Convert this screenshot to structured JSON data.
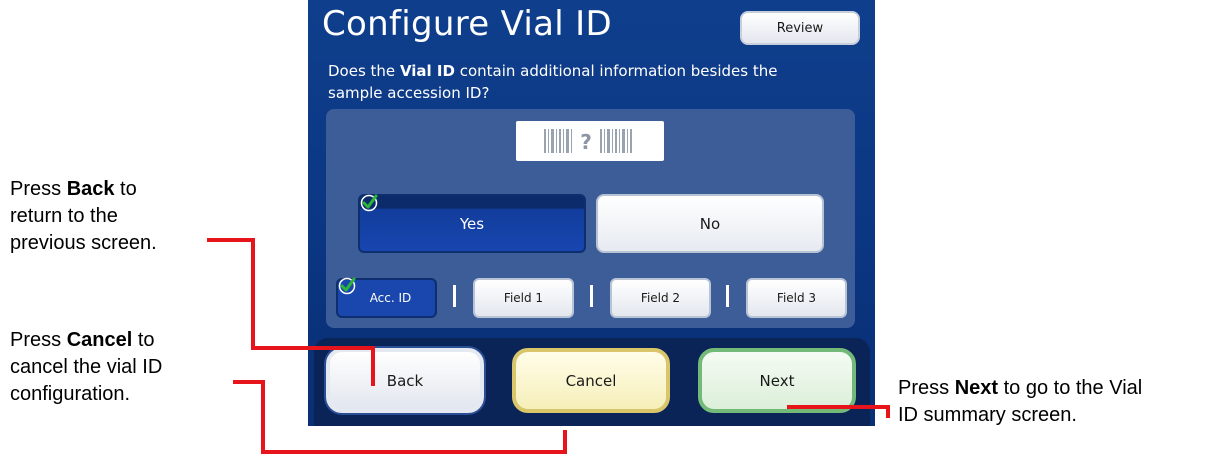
{
  "screen": {
    "title": "Configure Vial ID",
    "review_label": "Review",
    "question": {
      "part1": "Does the ",
      "bold": "Vial ID",
      "part2": " contain additional information besides the sample accession ID?"
    },
    "barcode_glyph": "?",
    "choices": {
      "yes_label": "Yes",
      "no_label": "No",
      "selected": "Yes"
    },
    "fields": [
      {
        "label": "Acc. ID",
        "selected": true
      },
      {
        "label": "Field 1",
        "selected": false
      },
      {
        "label": "Field 2",
        "selected": false
      },
      {
        "label": "Field 3",
        "selected": false
      }
    ],
    "nav": {
      "back_label": "Back",
      "cancel_label": "Cancel",
      "next_label": "Next"
    }
  },
  "annotations": {
    "back": {
      "pre": "Press ",
      "bold": "Back",
      "line1_post": " to",
      "line2": "return to the",
      "line3": "previous screen."
    },
    "cancel": {
      "pre": "Press ",
      "bold": "Cancel",
      "line1_post": " to",
      "line2": "cancel the vial ID",
      "line3": "configuration."
    },
    "next": {
      "pre": "Press ",
      "bold": "Next",
      "line1_post": " to go to the Vial",
      "line2": "ID summary screen."
    }
  },
  "colors": {
    "screen_bg": "#0b3683",
    "panel_bg": "#3c5d98",
    "selected_blue": "#1846b0",
    "callout_line": "#e8141c",
    "check_green": "#2db53a"
  }
}
